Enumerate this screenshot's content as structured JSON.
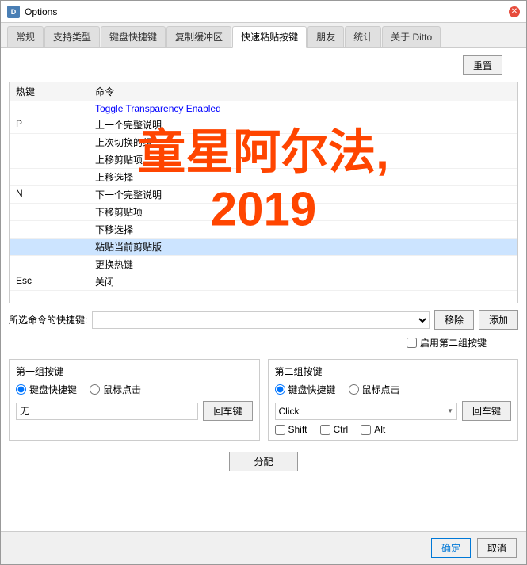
{
  "window": {
    "title": "Options",
    "icon": "options-icon"
  },
  "tabs": [
    {
      "label": "常规",
      "active": false
    },
    {
      "label": "支持类型",
      "active": false
    },
    {
      "label": "键盘快捷键",
      "active": false
    },
    {
      "label": "复制缓冲区",
      "active": false
    },
    {
      "label": "快速粘贴按键",
      "active": true
    },
    {
      "label": "朋友",
      "active": false
    },
    {
      "label": "统计",
      "active": false
    },
    {
      "label": "关于 Ditto",
      "active": false
    }
  ],
  "reset_button": "重置",
  "table": {
    "header": {
      "hotkey": "热键",
      "command": "命令"
    },
    "rows": [
      {
        "hotkey": "",
        "command": "Toggle Transparency Enabled",
        "blue": true
      },
      {
        "hotkey": "P",
        "command": "上一个完整说明"
      },
      {
        "hotkey": "",
        "command": "上次切换的组"
      },
      {
        "hotkey": "",
        "command": "上移剪贴项"
      },
      {
        "hotkey": "",
        "command": "上移选择"
      },
      {
        "hotkey": "N",
        "command": "下一个完整说明"
      },
      {
        "hotkey": "",
        "command": "下移剪贴项"
      },
      {
        "hotkey": "",
        "command": "下移选择"
      },
      {
        "hotkey": "",
        "command": "粘贴当前剪贴版"
      },
      {
        "hotkey": "",
        "command": "更换热键"
      },
      {
        "hotkey": "Esc",
        "command": "关闭"
      }
    ]
  },
  "shortcut_label": "所选命令的快捷键:",
  "remove_button": "移除",
  "add_button": "添加",
  "enable_second_label": "启用第二组按键",
  "group1": {
    "title": "第一组按键",
    "keyboard_label": "键盘快捷键",
    "mouse_label": "鼠标点击",
    "input_value": "无",
    "enter_button": "回车键"
  },
  "group2": {
    "title": "第二组按键",
    "keyboard_label": "键盘快捷键",
    "mouse_label": "鼠标点击",
    "dropdown_value": "Click",
    "enter_button": "回车键",
    "checkboxes": [
      {
        "label": "Shift",
        "checked": false
      },
      {
        "label": "Ctrl",
        "checked": false
      },
      {
        "label": "Alt",
        "checked": false
      }
    ]
  },
  "assign_button": "分配",
  "footer": {
    "ok_button": "确定",
    "cancel_button": "取消"
  },
  "watermark": {
    "line1": "童星阿尔法,",
    "line2": "2019"
  }
}
